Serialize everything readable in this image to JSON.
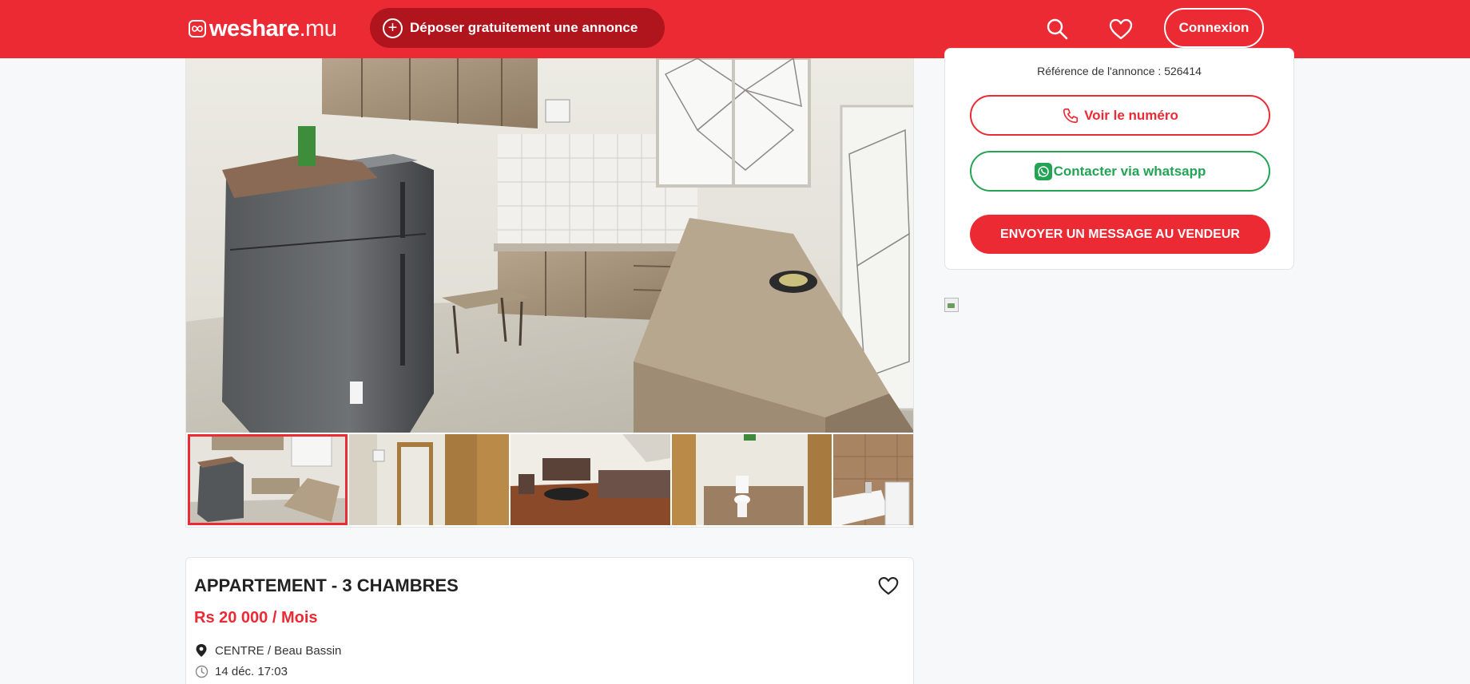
{
  "header": {
    "logo": {
      "name": "weshare",
      "tld": ".mu"
    },
    "post_ad_label": "Déposer gratuitement une annonce",
    "search_icon": "search-icon",
    "favorites_icon": "heart-icon",
    "login_label": "Connexion"
  },
  "gallery": {
    "photos": [
      {
        "alt": "kitchen with fridge and counter",
        "active": true
      },
      {
        "alt": "hallway with doors",
        "active": false
      },
      {
        "alt": "living room with sofa and table",
        "active": false
      },
      {
        "alt": "toilet",
        "active": false
      },
      {
        "alt": "bathroom sink",
        "active": false
      }
    ]
  },
  "listing": {
    "title": "APPARTEMENT - 3 CHAMBRES",
    "price": "Rs 20 000 / Mois",
    "location": "CENTRE / Beau Bassin",
    "date": "14 déc. 17:03"
  },
  "seller": {
    "reference": "Référence de l'annonce : 526414",
    "show_number_label": "Voir le numéro",
    "whatsapp_label": "Contacter via whatsapp",
    "message_label": "ENVOYER UN MESSAGE AU VENDEUR"
  },
  "colors": {
    "brand_red": "#ec2a34",
    "whatsapp_green": "#23a455",
    "background": "#f7f8f9"
  }
}
